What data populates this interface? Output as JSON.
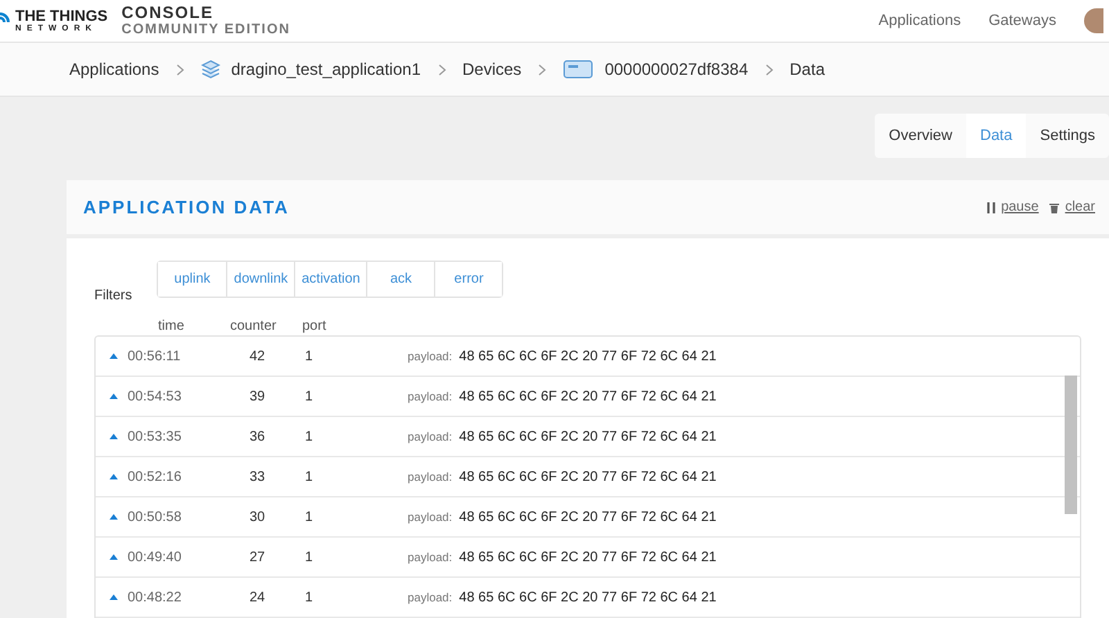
{
  "header": {
    "logo_top": "THE THINGS",
    "logo_bottom": "NETWORK",
    "title": "CONSOLE",
    "subtitle": "COMMUNITY EDITION",
    "nav": [
      "Applications",
      "Gateways"
    ]
  },
  "breadcrumb": [
    {
      "label": "Applications",
      "kind": "text"
    },
    {
      "label": "dragino_test_application1",
      "kind": "app"
    },
    {
      "label": "Devices",
      "kind": "text"
    },
    {
      "label": "0000000027df8384",
      "kind": "device"
    },
    {
      "label": "Data",
      "kind": "text"
    }
  ],
  "tabs": [
    {
      "label": "Overview",
      "selected": false
    },
    {
      "label": "Data",
      "selected": true
    },
    {
      "label": "Settings",
      "selected": false
    }
  ],
  "card": {
    "title": "APPLICATION DATA",
    "pause": "pause",
    "clear": "clear"
  },
  "filters": {
    "label": "Filters",
    "items": [
      {
        "label": "uplink",
        "selected": false
      },
      {
        "label": "downlink",
        "selected": false
      },
      {
        "label": "activation",
        "selected": false
      },
      {
        "label": "ack",
        "selected": false
      },
      {
        "label": "error",
        "selected": false
      }
    ]
  },
  "table": {
    "columns": [
      "time",
      "counter",
      "port"
    ],
    "rows": [
      {
        "time": "00:56:11",
        "counter": "42",
        "port": "1",
        "payload_label": "payload:",
        "payload": "48 65 6C 6C 6F 2C 20 77 6F 72 6C 64 21"
      },
      {
        "time": "00:54:53",
        "counter": "39",
        "port": "1",
        "payload_label": "payload:",
        "payload": "48 65 6C 6C 6F 2C 20 77 6F 72 6C 64 21"
      },
      {
        "time": "00:53:35",
        "counter": "36",
        "port": "1",
        "payload_label": "payload:",
        "payload": "48 65 6C 6C 6F 2C 20 77 6F 72 6C 64 21"
      },
      {
        "time": "00:52:16",
        "counter": "33",
        "port": "1",
        "payload_label": "payload:",
        "payload": "48 65 6C 6C 6F 2C 20 77 6F 72 6C 64 21"
      },
      {
        "time": "00:50:58",
        "counter": "30",
        "port": "1",
        "payload_label": "payload:",
        "payload": "48 65 6C 6C 6F 2C 20 77 6F 72 6C 64 21"
      },
      {
        "time": "00:49:40",
        "counter": "27",
        "port": "1",
        "payload_label": "payload:",
        "payload": "48 65 6C 6C 6F 2C 20 77 6F 72 6C 64 21"
      },
      {
        "time": "00:48:22",
        "counter": "24",
        "port": "1",
        "payload_label": "payload:",
        "payload": "48 65 6C 6C 6F 2C 20 77 6F 72 6C 64 21"
      }
    ]
  }
}
